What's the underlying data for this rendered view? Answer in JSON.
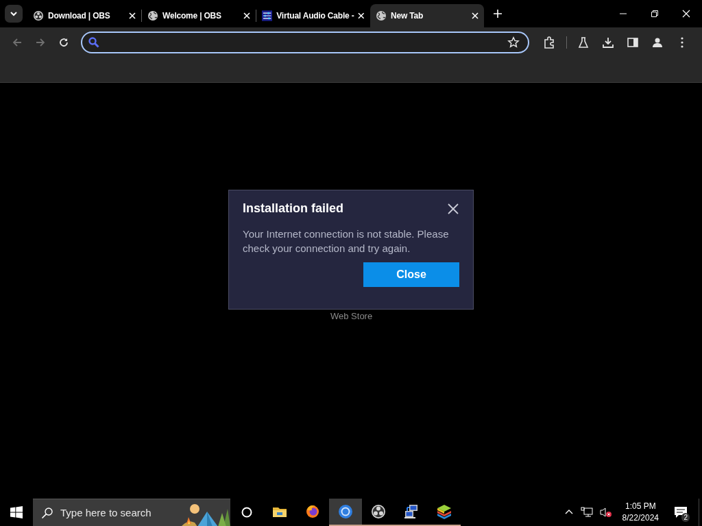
{
  "tabs": [
    {
      "title": "Download | OBS",
      "kind": "obs",
      "selected": false
    },
    {
      "title": "Welcome | OBS",
      "kind": "globe",
      "selected": false
    },
    {
      "title": "Virtual Audio Cable -",
      "kind": "vac",
      "selected": false
    },
    {
      "title": "New Tab",
      "kind": "globe",
      "selected": true
    }
  ],
  "page": {
    "caption": "Web Store"
  },
  "dialog": {
    "title": "Installation failed",
    "message": "Your Internet connection is not stable. Please check your connection and try again.",
    "button": "Close"
  },
  "taskbar": {
    "search_placeholder": "Type here to search",
    "apps": [
      {
        "kind": "explorer",
        "running": false,
        "selected": false
      },
      {
        "kind": "firefox",
        "running": false,
        "selected": false
      },
      {
        "kind": "chrome",
        "running": true,
        "selected": true
      },
      {
        "kind": "obs",
        "running": true,
        "selected": false
      },
      {
        "kind": "network",
        "running": true,
        "selected": false
      },
      {
        "kind": "stack",
        "running": true,
        "selected": false
      }
    ],
    "time": "1:05 PM",
    "date": "8/22/2024",
    "notifications": "2"
  }
}
